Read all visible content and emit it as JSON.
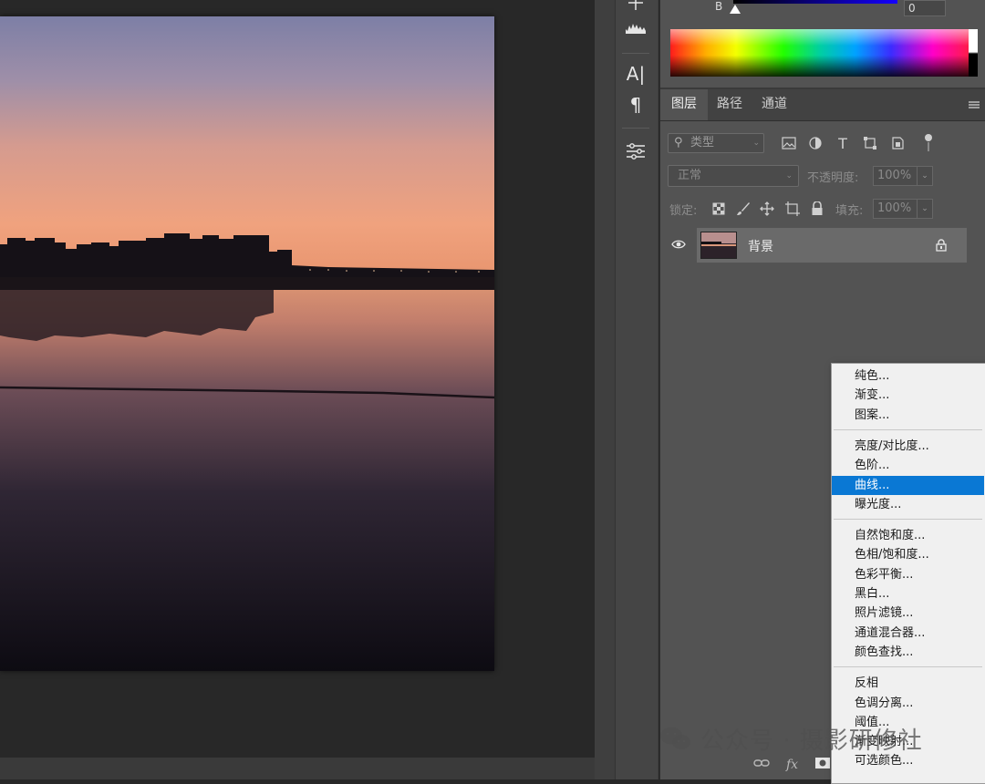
{
  "color_panel": {
    "channel_label": "B",
    "channel_value": "0"
  },
  "tools": [
    {
      "icon": "move-icon"
    },
    {
      "icon": "histogram-icon"
    },
    {
      "icon": "character-icon",
      "label": "A|"
    },
    {
      "icon": "paragraph-icon",
      "label": "¶"
    },
    {
      "icon": "adjustments-icon"
    }
  ],
  "layers_panel": {
    "tabs": [
      {
        "label": "图层",
        "active": true
      },
      {
        "label": "路径",
        "active": false
      },
      {
        "label": "通道",
        "active": false
      }
    ],
    "filter_placeholder": "类型",
    "filter_icons": [
      "image-filter-icon",
      "adjustment-filter-icon",
      "type-filter-icon",
      "shape-filter-icon",
      "smart-object-filter-icon",
      "filter-toggle-icon"
    ],
    "blend_mode": "正常",
    "opacity_label": "不透明度:",
    "opacity_value": "100%",
    "lock_label": "锁定:",
    "lock_icons": [
      "lock-transparent-icon",
      "lock-paint-icon",
      "lock-position-icon",
      "lock-artboard-icon",
      "lock-all-icon"
    ],
    "fill_label": "填充:",
    "fill_value": "100%",
    "layers": [
      {
        "name": "背景",
        "visible": true,
        "locked": true
      }
    ],
    "footer_icons": [
      "link-icon",
      "fx-icon",
      "mask-icon"
    ]
  },
  "context_menu": {
    "groups": [
      [
        "纯色...",
        "渐变...",
        "图案..."
      ],
      [
        "亮度/对比度...",
        "色阶...",
        "曲线...",
        "曝光度..."
      ],
      [
        "自然饱和度...",
        "色相/饱和度...",
        "色彩平衡...",
        "黑白...",
        "照片滤镜...",
        "通道混合器...",
        "颜色查找..."
      ],
      [
        "反相",
        "色调分离...",
        "阈值...",
        "渐变映射...",
        "可选颜色..."
      ]
    ],
    "selected": "曲线..."
  },
  "watermark": {
    "text": "公众号 · 摄影研修社"
  },
  "colors": {
    "accent": "#0a78d4",
    "panel_bg": "#535353",
    "canvas_bg": "#282828"
  }
}
